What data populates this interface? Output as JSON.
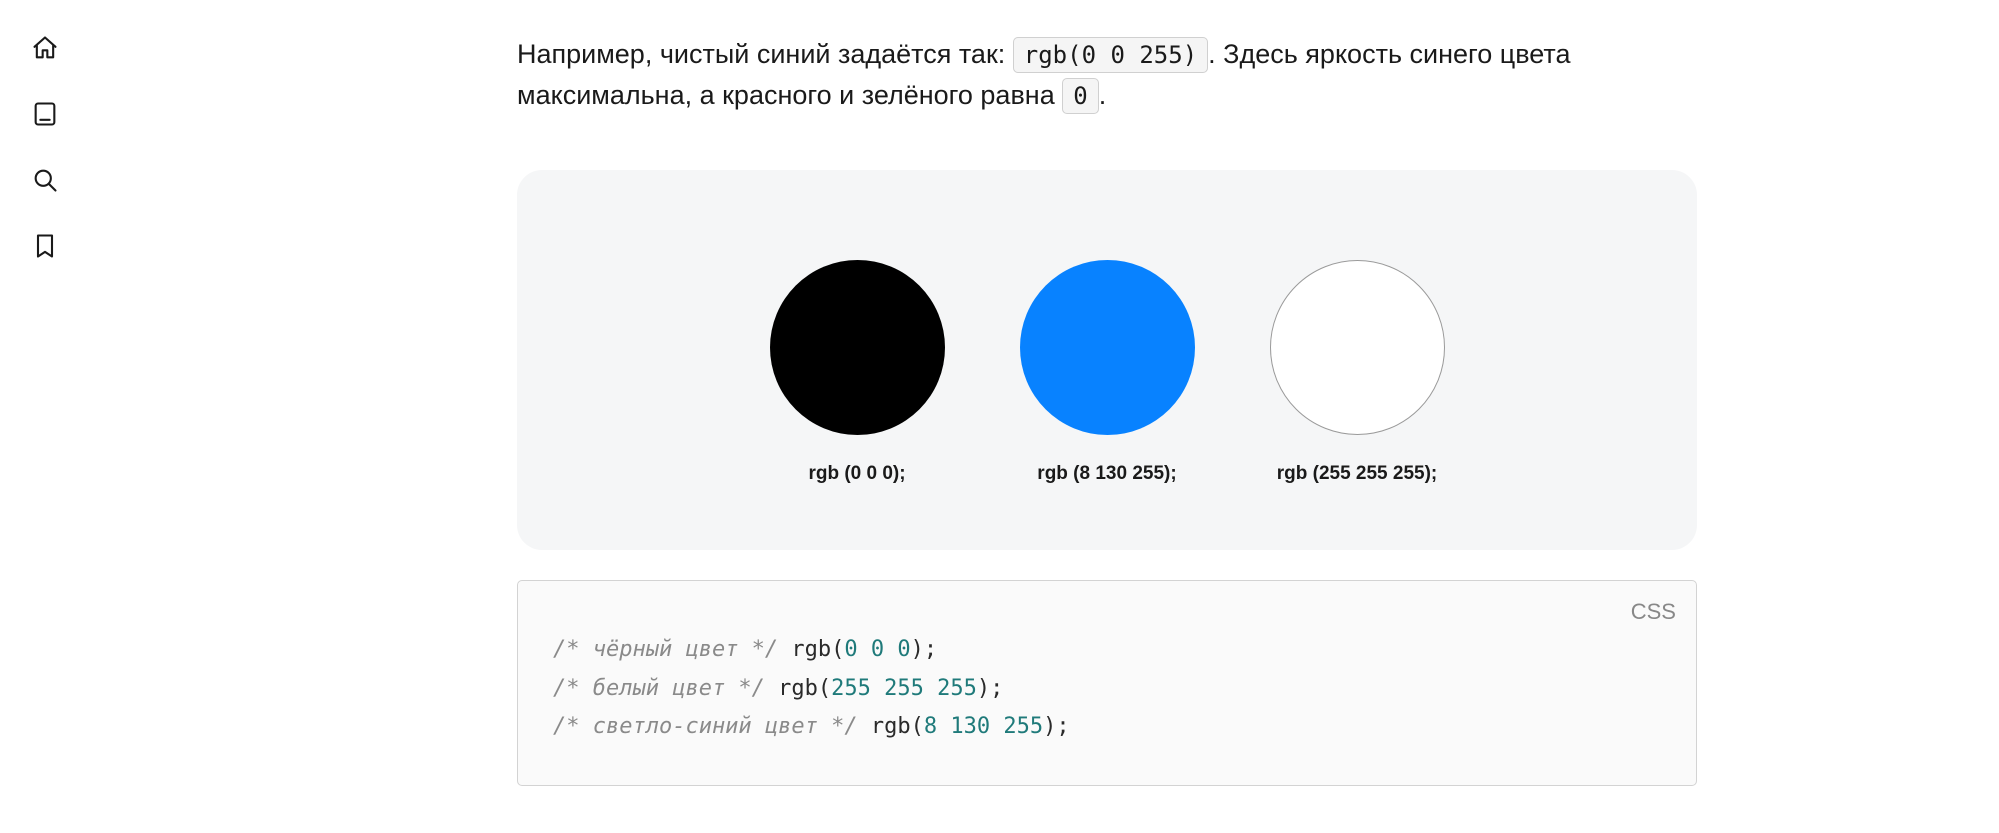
{
  "sidebar": {
    "items": [
      {
        "name": "home-icon"
      },
      {
        "name": "book-icon"
      },
      {
        "name": "search-icon"
      },
      {
        "name": "bookmark-icon"
      }
    ]
  },
  "paragraph": {
    "part1": "Например, чистый синий задаётся так: ",
    "code1": "rgb(0 0 255)",
    "part2": ". Здесь яркость синего цвета максимальна, а красного и зелёного равна ",
    "code2": "0",
    "part3": "."
  },
  "swatches": [
    {
      "label": "rgb (0 0 0);",
      "color_class": "black"
    },
    {
      "label": "rgb (8 130 255);",
      "color_class": "blue"
    },
    {
      "label": "rgb (255 255 255);",
      "color_class": "white"
    }
  ],
  "code": {
    "lang": "CSS",
    "lines": [
      {
        "comment": "/* чёрный цвет */",
        "pad": " ",
        "fn": "rgb",
        "open": "(",
        "args": [
          "0",
          "0",
          "0"
        ],
        "close": ");"
      },
      {
        "comment": "/* белый цвет */",
        "pad": "  ",
        "fn": "rgb",
        "open": "(",
        "args": [
          "255",
          "255",
          "255"
        ],
        "close": ");"
      },
      {
        "comment": "/* светло-синий цвет */",
        "pad": " ",
        "fn": "rgb",
        "open": "(",
        "args": [
          "8",
          "130",
          "255"
        ],
        "close": ");"
      }
    ]
  }
}
